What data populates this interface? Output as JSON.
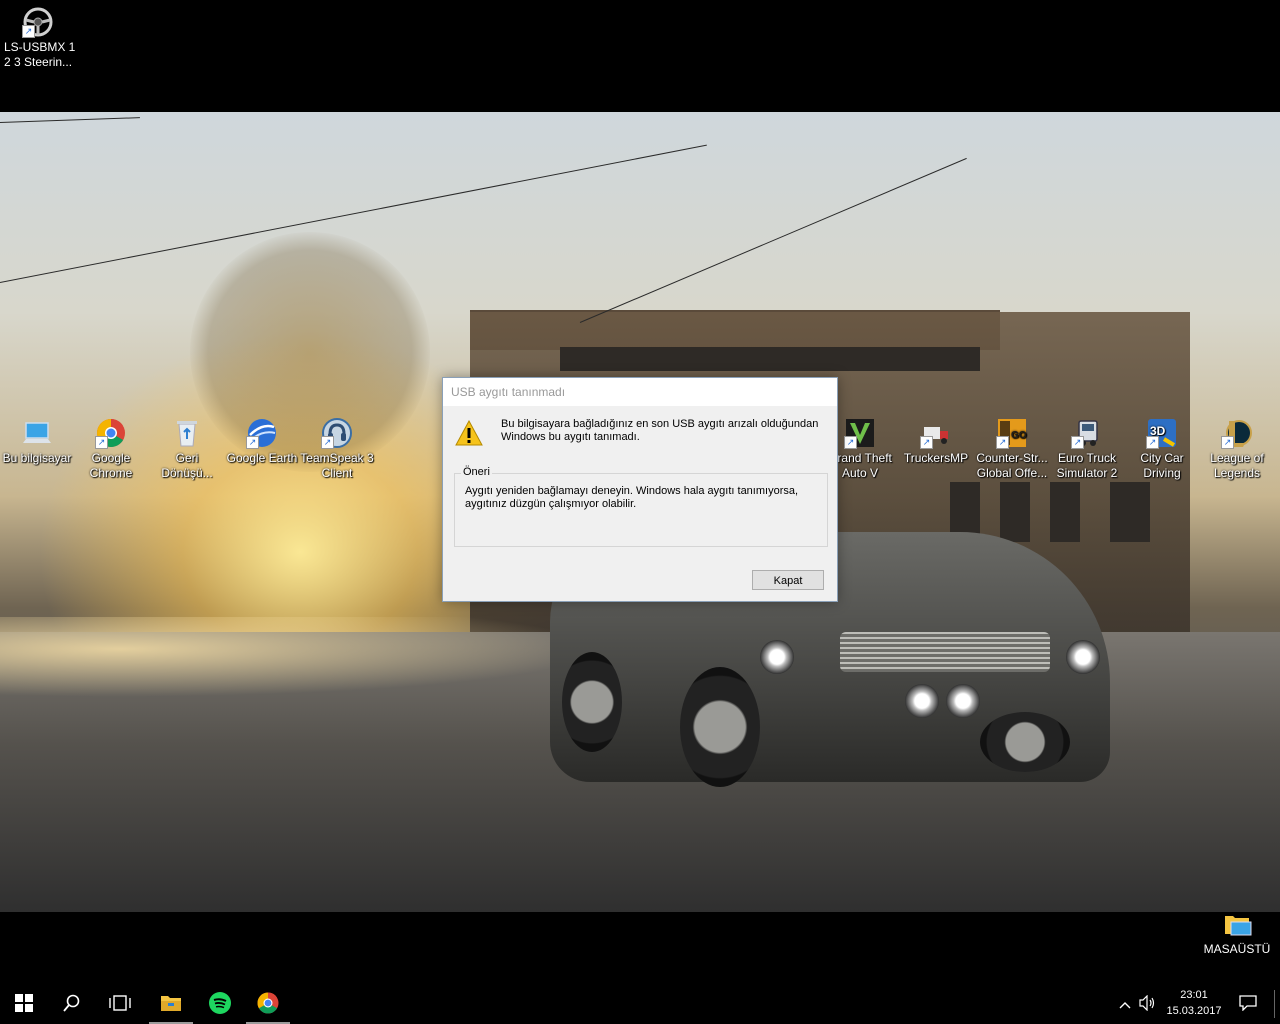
{
  "desktop": {
    "top_icon": {
      "line1": "LS-USBMX 1",
      "line2": "2 3 Steerin...",
      "icon": "steering-wheel-icon"
    },
    "left_icons": [
      {
        "label": "Bu bilgisayar",
        "icon": "computer-icon"
      },
      {
        "label": "Google Chrome",
        "icon": "chrome-icon"
      },
      {
        "label": "Geri Dönüşü...",
        "icon": "recycle-bin-icon"
      },
      {
        "label": "Google Earth",
        "icon": "google-earth-icon"
      },
      {
        "label": "TeamSpeak 3 Client",
        "icon": "teamspeak-icon"
      }
    ],
    "right_icons": [
      {
        "label": "Grand Theft Auto V",
        "icon": "gta-v-icon"
      },
      {
        "label": "TruckersMP",
        "icon": "truckersmp-icon"
      },
      {
        "label": "Counter-Str... Global Offe...",
        "icon": "csgo-icon"
      },
      {
        "label": "Euro Truck Simulator 2",
        "icon": "euro-truck-icon"
      },
      {
        "label": "City Car Driving",
        "icon": "city-car-driving-icon"
      },
      {
        "label": "League of Legends",
        "icon": "league-of-legends-icon"
      }
    ],
    "corner_icon": {
      "label": "MASAÜSTÜ",
      "icon": "desktop-folder-icon"
    }
  },
  "dialog": {
    "title": "USB aygıtı tanınmadı",
    "message_line1": "Bu bilgisayara bağladığınız en son USB aygıtı arızalı olduğundan",
    "message_line2": "Windows bu aygıtı tanımadı.",
    "group_label": "Öneri",
    "suggestion_line1": "Aygıtı yeniden bağlamayı deneyin. Windows hala aygıtı tanımıyorsa,",
    "suggestion_line2": "aygıtınız düzgün çalışmıyor olabilir.",
    "close_label": "Kapat"
  },
  "taskbar": {
    "buttons": [
      "windows-start-icon",
      "search-icon",
      "task-view-icon",
      "file-explorer-icon",
      "spotify-icon",
      "chrome-icon"
    ],
    "tray": {
      "chevron_icon": "chevron-up-icon",
      "volume_icon": "volume-icon",
      "time": "23:01",
      "date": "15.03.2017",
      "notification_icon": "notification-icon"
    }
  },
  "colors": {
    "dialog_border": "#8aa0b8",
    "dialog_bg": "#f0f0f0",
    "button_bg": "#e1e1e1",
    "chrome_red": "#db4437",
    "chrome_yellow": "#f4b400",
    "chrome_green": "#0f9d58",
    "chrome_blue": "#4285f4",
    "spotify_green": "#1ed760"
  }
}
